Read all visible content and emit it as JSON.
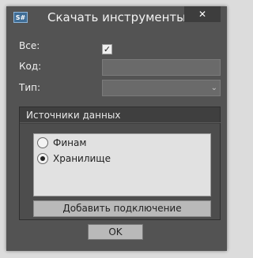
{
  "window": {
    "title": "Скачать инструменты",
    "app_icon_text": "S#",
    "close_symbol": "✕"
  },
  "form": {
    "all_label": "Все:",
    "all_checked": true,
    "check_mark": "✓",
    "code_label": "Код:",
    "code_value": "",
    "type_label": "Тип:",
    "type_value": "",
    "dropdown_symbol": "⌄"
  },
  "sources": {
    "title": "Источники данных",
    "items": [
      {
        "label": "Финам",
        "selected": false
      },
      {
        "label": "Хранилище",
        "selected": true
      }
    ],
    "add_label": "Добавить подключение"
  },
  "ok_label": "OK",
  "colors": {
    "window_bg": "#535353",
    "group_bg": "#3f3f3f",
    "list_bg": "#e1e1e1",
    "button_bg": "#b9b9b9"
  }
}
